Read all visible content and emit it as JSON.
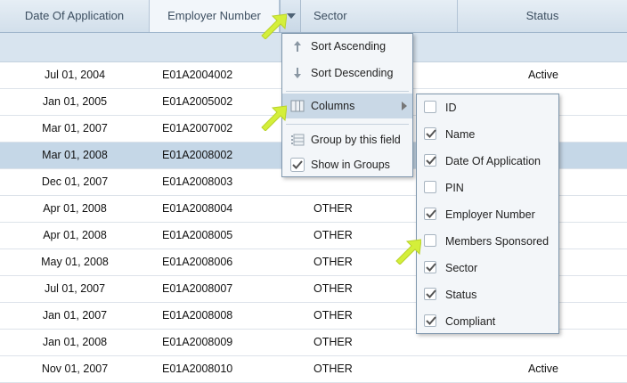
{
  "columns": {
    "date": "Date Of Application",
    "employer": "Employer Number",
    "sector": "Sector",
    "status": "Status"
  },
  "rows": [
    {
      "date": "Jul 01, 2004",
      "emp": "E01A2004002",
      "sector": "",
      "status": "Active"
    },
    {
      "date": "Jan 01, 2005",
      "emp": "E01A2005002",
      "sector": "",
      "status": ""
    },
    {
      "date": "Mar 01, 2007",
      "emp": "E01A2007002",
      "sector": "",
      "status": ""
    },
    {
      "date": "Mar 01, 2008",
      "emp": "E01A2008002",
      "sector": "",
      "status": ""
    },
    {
      "date": "Dec 01, 2007",
      "emp": "E01A2008003",
      "sector": "",
      "status": ""
    },
    {
      "date": "Apr 01, 2008",
      "emp": "E01A2008004",
      "sector": "OTHER",
      "status": ""
    },
    {
      "date": "Apr 01, 2008",
      "emp": "E01A2008005",
      "sector": "OTHER",
      "status": ""
    },
    {
      "date": "May 01, 2008",
      "emp": "E01A2008006",
      "sector": "OTHER",
      "status": ""
    },
    {
      "date": "Jul 01, 2007",
      "emp": "E01A2008007",
      "sector": "OTHER",
      "status": ""
    },
    {
      "date": "Jan 01, 2007",
      "emp": "E01A2008008",
      "sector": "OTHER",
      "status": ""
    },
    {
      "date": "Jan 01, 2008",
      "emp": "E01A2008009",
      "sector": "OTHER",
      "status": ""
    },
    {
      "date": "Nov 01, 2007",
      "emp": "E01A2008010",
      "sector": "OTHER",
      "status": "Active"
    }
  ],
  "menu": {
    "sort_asc": "Sort Ascending",
    "sort_desc": "Sort Descending",
    "columns": "Columns",
    "group_by": "Group by this field",
    "show_in_groups": "Show in Groups"
  },
  "column_items": [
    {
      "label": "ID",
      "checked": false
    },
    {
      "label": "Name",
      "checked": true
    },
    {
      "label": "Date Of Application",
      "checked": true
    },
    {
      "label": "PIN",
      "checked": false
    },
    {
      "label": "Employer Number",
      "checked": true
    },
    {
      "label": "Members Sponsored",
      "checked": false
    },
    {
      "label": "Sector",
      "checked": true
    },
    {
      "label": "Status",
      "checked": true
    },
    {
      "label": "Compliant",
      "checked": true
    }
  ],
  "colors": {
    "header_bg": "#d8e4ef",
    "selected_row": "#c5d7e7",
    "menu_highlight": "#c9d8e6",
    "pointer": "#d4ef3a"
  },
  "icons": {
    "sort_asc": "arrow-up-icon",
    "sort_desc": "arrow-down-icon",
    "columns": "columns-icon",
    "group_by": "group-icon",
    "show_in_groups": "checkmark-icon",
    "pointer": "arrow-pointer-icon"
  }
}
